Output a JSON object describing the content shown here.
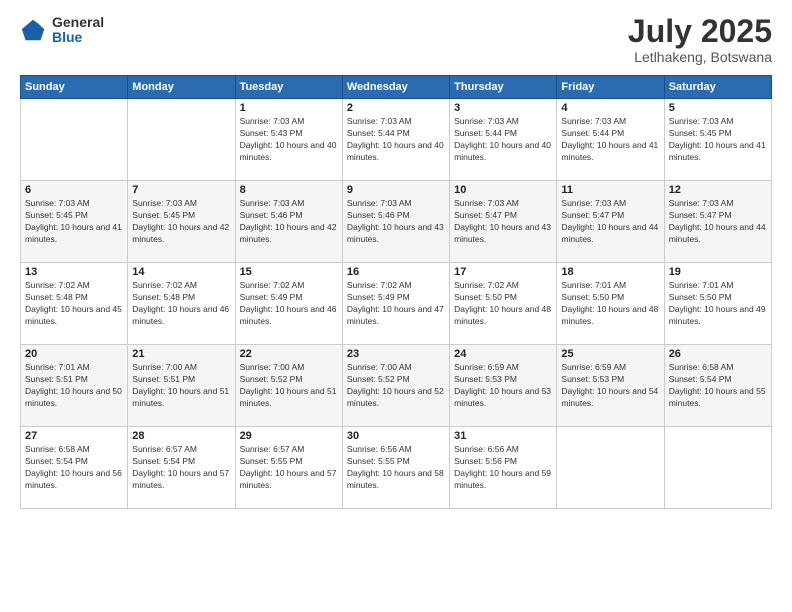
{
  "logo": {
    "general": "General",
    "blue": "Blue"
  },
  "title": "July 2025",
  "location": "Letlhakeng, Botswana",
  "headers": [
    "Sunday",
    "Monday",
    "Tuesday",
    "Wednesday",
    "Thursday",
    "Friday",
    "Saturday"
  ],
  "weeks": [
    [
      {
        "day": "",
        "sunrise": "",
        "sunset": "",
        "daylight": ""
      },
      {
        "day": "",
        "sunrise": "",
        "sunset": "",
        "daylight": ""
      },
      {
        "day": "1",
        "sunrise": "Sunrise: 7:03 AM",
        "sunset": "Sunset: 5:43 PM",
        "daylight": "Daylight: 10 hours and 40 minutes."
      },
      {
        "day": "2",
        "sunrise": "Sunrise: 7:03 AM",
        "sunset": "Sunset: 5:44 PM",
        "daylight": "Daylight: 10 hours and 40 minutes."
      },
      {
        "day": "3",
        "sunrise": "Sunrise: 7:03 AM",
        "sunset": "Sunset: 5:44 PM",
        "daylight": "Daylight: 10 hours and 40 minutes."
      },
      {
        "day": "4",
        "sunrise": "Sunrise: 7:03 AM",
        "sunset": "Sunset: 5:44 PM",
        "daylight": "Daylight: 10 hours and 41 minutes."
      },
      {
        "day": "5",
        "sunrise": "Sunrise: 7:03 AM",
        "sunset": "Sunset: 5:45 PM",
        "daylight": "Daylight: 10 hours and 41 minutes."
      }
    ],
    [
      {
        "day": "6",
        "sunrise": "Sunrise: 7:03 AM",
        "sunset": "Sunset: 5:45 PM",
        "daylight": "Daylight: 10 hours and 41 minutes."
      },
      {
        "day": "7",
        "sunrise": "Sunrise: 7:03 AM",
        "sunset": "Sunset: 5:45 PM",
        "daylight": "Daylight: 10 hours and 42 minutes."
      },
      {
        "day": "8",
        "sunrise": "Sunrise: 7:03 AM",
        "sunset": "Sunset: 5:46 PM",
        "daylight": "Daylight: 10 hours and 42 minutes."
      },
      {
        "day": "9",
        "sunrise": "Sunrise: 7:03 AM",
        "sunset": "Sunset: 5:46 PM",
        "daylight": "Daylight: 10 hours and 43 minutes."
      },
      {
        "day": "10",
        "sunrise": "Sunrise: 7:03 AM",
        "sunset": "Sunset: 5:47 PM",
        "daylight": "Daylight: 10 hours and 43 minutes."
      },
      {
        "day": "11",
        "sunrise": "Sunrise: 7:03 AM",
        "sunset": "Sunset: 5:47 PM",
        "daylight": "Daylight: 10 hours and 44 minutes."
      },
      {
        "day": "12",
        "sunrise": "Sunrise: 7:03 AM",
        "sunset": "Sunset: 5:47 PM",
        "daylight": "Daylight: 10 hours and 44 minutes."
      }
    ],
    [
      {
        "day": "13",
        "sunrise": "Sunrise: 7:02 AM",
        "sunset": "Sunset: 5:48 PM",
        "daylight": "Daylight: 10 hours and 45 minutes."
      },
      {
        "day": "14",
        "sunrise": "Sunrise: 7:02 AM",
        "sunset": "Sunset: 5:48 PM",
        "daylight": "Daylight: 10 hours and 46 minutes."
      },
      {
        "day": "15",
        "sunrise": "Sunrise: 7:02 AM",
        "sunset": "Sunset: 5:49 PM",
        "daylight": "Daylight: 10 hours and 46 minutes."
      },
      {
        "day": "16",
        "sunrise": "Sunrise: 7:02 AM",
        "sunset": "Sunset: 5:49 PM",
        "daylight": "Daylight: 10 hours and 47 minutes."
      },
      {
        "day": "17",
        "sunrise": "Sunrise: 7:02 AM",
        "sunset": "Sunset: 5:50 PM",
        "daylight": "Daylight: 10 hours and 48 minutes."
      },
      {
        "day": "18",
        "sunrise": "Sunrise: 7:01 AM",
        "sunset": "Sunset: 5:50 PM",
        "daylight": "Daylight: 10 hours and 48 minutes."
      },
      {
        "day": "19",
        "sunrise": "Sunrise: 7:01 AM",
        "sunset": "Sunset: 5:50 PM",
        "daylight": "Daylight: 10 hours and 49 minutes."
      }
    ],
    [
      {
        "day": "20",
        "sunrise": "Sunrise: 7:01 AM",
        "sunset": "Sunset: 5:51 PM",
        "daylight": "Daylight: 10 hours and 50 minutes."
      },
      {
        "day": "21",
        "sunrise": "Sunrise: 7:00 AM",
        "sunset": "Sunset: 5:51 PM",
        "daylight": "Daylight: 10 hours and 51 minutes."
      },
      {
        "day": "22",
        "sunrise": "Sunrise: 7:00 AM",
        "sunset": "Sunset: 5:52 PM",
        "daylight": "Daylight: 10 hours and 51 minutes."
      },
      {
        "day": "23",
        "sunrise": "Sunrise: 7:00 AM",
        "sunset": "Sunset: 5:52 PM",
        "daylight": "Daylight: 10 hours and 52 minutes."
      },
      {
        "day": "24",
        "sunrise": "Sunrise: 6:59 AM",
        "sunset": "Sunset: 5:53 PM",
        "daylight": "Daylight: 10 hours and 53 minutes."
      },
      {
        "day": "25",
        "sunrise": "Sunrise: 6:59 AM",
        "sunset": "Sunset: 5:53 PM",
        "daylight": "Daylight: 10 hours and 54 minutes."
      },
      {
        "day": "26",
        "sunrise": "Sunrise: 6:58 AM",
        "sunset": "Sunset: 5:54 PM",
        "daylight": "Daylight: 10 hours and 55 minutes."
      }
    ],
    [
      {
        "day": "27",
        "sunrise": "Sunrise: 6:58 AM",
        "sunset": "Sunset: 5:54 PM",
        "daylight": "Daylight: 10 hours and 56 minutes."
      },
      {
        "day": "28",
        "sunrise": "Sunrise: 6:57 AM",
        "sunset": "Sunset: 5:54 PM",
        "daylight": "Daylight: 10 hours and 57 minutes."
      },
      {
        "day": "29",
        "sunrise": "Sunrise: 6:57 AM",
        "sunset": "Sunset: 5:55 PM",
        "daylight": "Daylight: 10 hours and 57 minutes."
      },
      {
        "day": "30",
        "sunrise": "Sunrise: 6:56 AM",
        "sunset": "Sunset: 5:55 PM",
        "daylight": "Daylight: 10 hours and 58 minutes."
      },
      {
        "day": "31",
        "sunrise": "Sunrise: 6:56 AM",
        "sunset": "Sunset: 5:56 PM",
        "daylight": "Daylight: 10 hours and 59 minutes."
      },
      {
        "day": "",
        "sunrise": "",
        "sunset": "",
        "daylight": ""
      },
      {
        "day": "",
        "sunrise": "",
        "sunset": "",
        "daylight": ""
      }
    ]
  ]
}
